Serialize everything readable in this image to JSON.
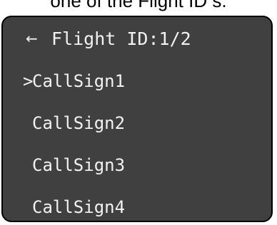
{
  "caption": "one of the Flight ID s.",
  "screen": {
    "back_icon": "←",
    "title": "Flight ID:1/2",
    "selection_marker": ">",
    "items": [
      {
        "label": "CallSign1",
        "selected": true
      },
      {
        "label": "CallSign2",
        "selected": false
      },
      {
        "label": "CallSign3",
        "selected": false
      },
      {
        "label": "CallSign4",
        "selected": false
      }
    ]
  }
}
